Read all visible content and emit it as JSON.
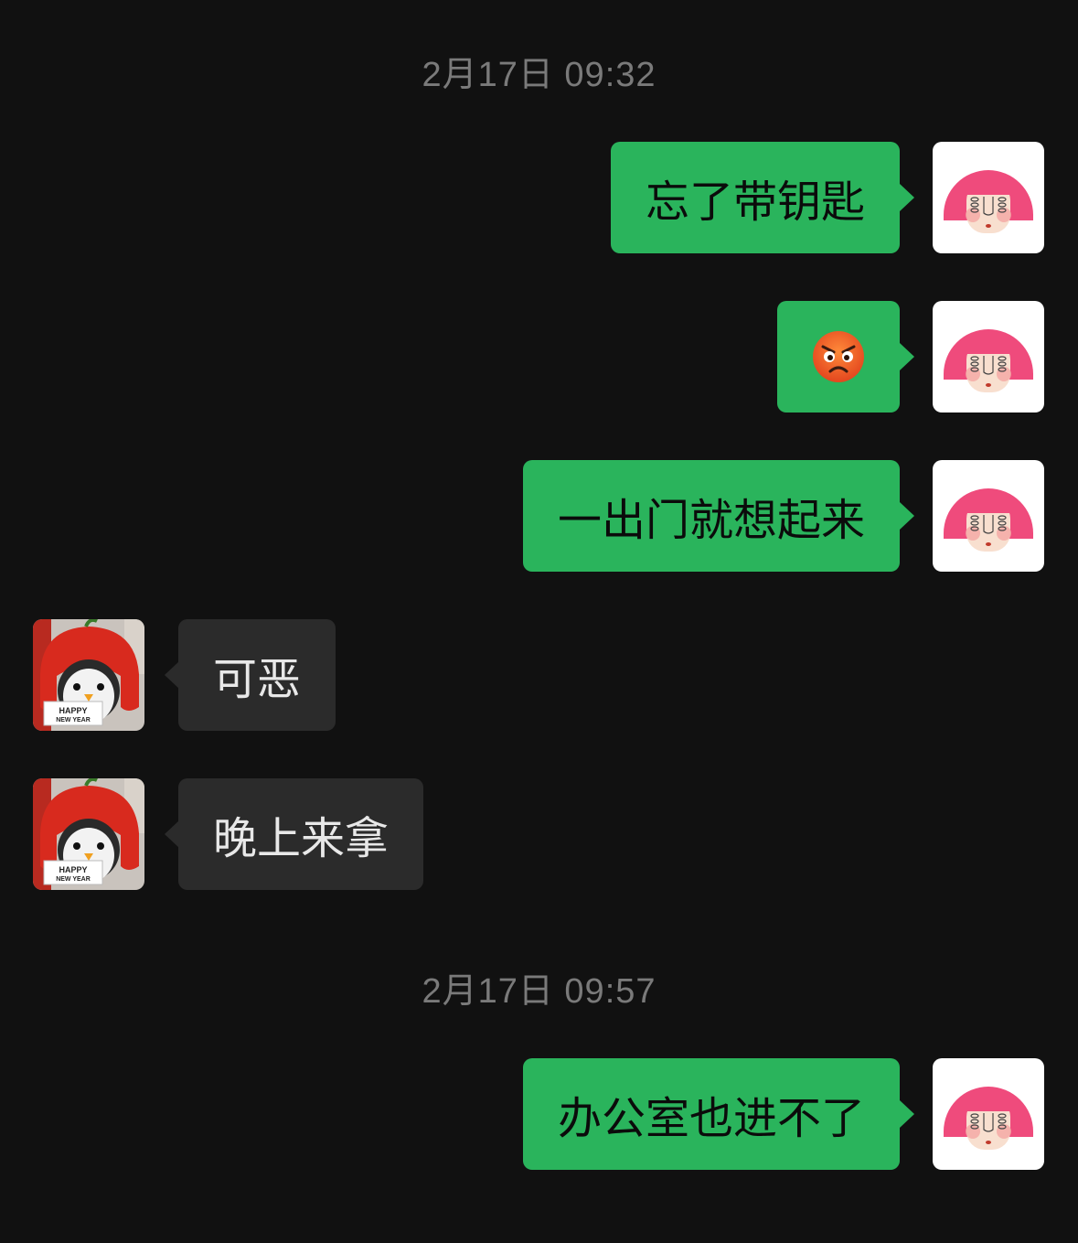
{
  "timestamps": [
    "2月17日 09:32",
    "2月17日 09:57"
  ],
  "messages": [
    {
      "sender": "self",
      "text": "忘了带钥匙"
    },
    {
      "sender": "self",
      "emoji": "angry-face-emoji"
    },
    {
      "sender": "self",
      "text": "一出门就想起来"
    },
    {
      "sender": "other",
      "text": "可恶"
    },
    {
      "sender": "other",
      "text": "晚上来拿"
    },
    {
      "sender": "self",
      "text": "办公室也进不了"
    }
  ],
  "avatars": {
    "self": {
      "icon": "pink-hair-girl-avatar"
    },
    "other": {
      "icon": "penguin-red-hat-avatar",
      "card_line1": "HAPPY",
      "card_line2": "NEW YEAR"
    }
  },
  "colors": {
    "background": "#111111",
    "self_bubble": "#2ab45c",
    "other_bubble": "#2b2b2b",
    "timestamp": "#7a7a7a"
  }
}
